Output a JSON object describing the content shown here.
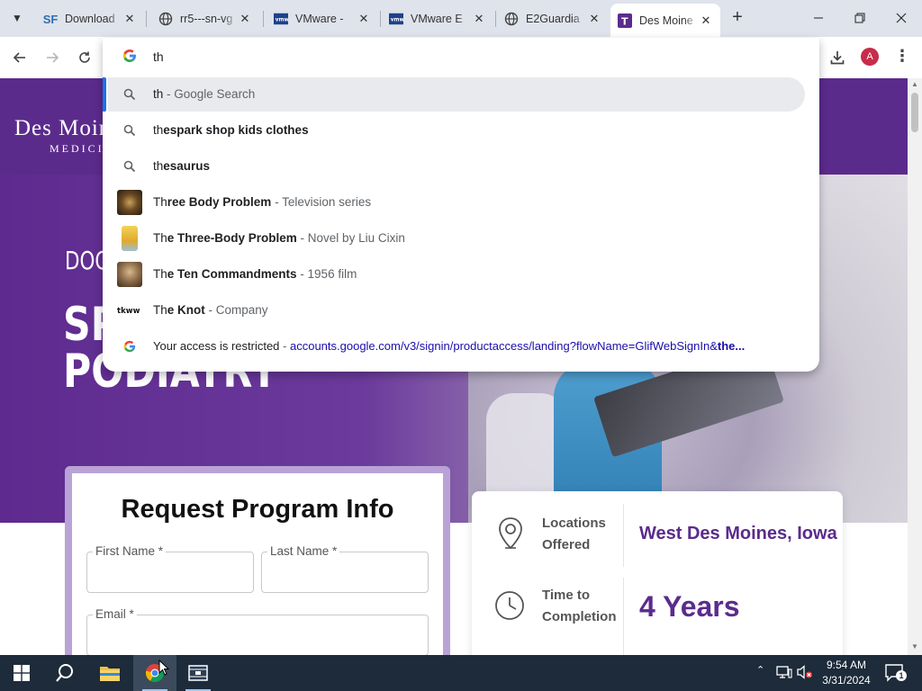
{
  "tabs": [
    {
      "title": "Download",
      "favicon": "SF",
      "fav_color": "#2f6fb0"
    },
    {
      "title": "rr5---sn-vg",
      "favicon": "globe",
      "fav_color": "#444444"
    },
    {
      "title": "VMware -",
      "favicon": "vmw",
      "fav_color": "#1d428a"
    },
    {
      "title": "VMware E",
      "favicon": "vmw",
      "fav_color": "#1d428a"
    },
    {
      "title": "E2Guardia",
      "favicon": "globe",
      "fav_color": "#444444"
    },
    {
      "title": "Des Moine",
      "favicon": "T",
      "fav_color": "#5b2b8c"
    }
  ],
  "omnibox": {
    "query": "th",
    "suggestions": [
      {
        "type": "search",
        "typed": "th",
        "rest": "",
        "suffix": " - Google Search"
      },
      {
        "type": "search",
        "typed": "th",
        "rest": "espark shop kids clothes",
        "suffix": ""
      },
      {
        "type": "search",
        "typed": "th",
        "rest": "esaurus",
        "suffix": ""
      },
      {
        "type": "entity",
        "typed": "Th",
        "rest": "ree Body Problem",
        "suffix": " - Television series"
      },
      {
        "type": "entity",
        "typed": "Th",
        "rest": "e Three-Body Problem",
        "suffix": " - Novel by Liu Cixin"
      },
      {
        "type": "entity",
        "typed": "Th",
        "rest": "e Ten Commandments",
        "suffix": " - 1956 film"
      },
      {
        "type": "entity",
        "typed": "Th",
        "rest": "e Knot",
        "suffix": " - Company"
      },
      {
        "type": "url",
        "title": "Your access is restricted",
        "url": "accounts.google.com/v3/signin/productaccess/landing?flowName=GlifWebSignIn&",
        "url_bold": "the..."
      }
    ]
  },
  "toolbar": {
    "profile_initial": "A"
  },
  "page": {
    "logo_line1": "Des Moines",
    "logo_line2": "MEDICINE",
    "hero_kicker": "DOC",
    "hero_title_1": "SP",
    "hero_title_2": "PODIATRY",
    "form": {
      "title": "Request Program Info",
      "first_name_label": "First Name *",
      "last_name_label": "Last Name *",
      "email_label": "Email *"
    },
    "info": {
      "locations_label_1": "Locations",
      "locations_label_2": "Offered",
      "locations_value": "West Des Moines, Iowa",
      "time_label_1": "Time to",
      "time_label_2": "Completion",
      "time_value": "4 Years"
    }
  },
  "taskbar": {
    "time": "9:54 AM",
    "date": "3/31/2024",
    "notification_count": "1"
  }
}
